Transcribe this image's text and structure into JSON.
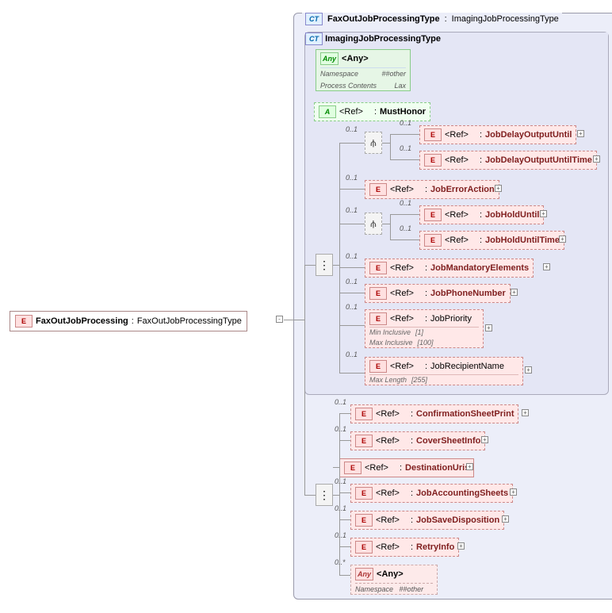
{
  "root": {
    "icon": "E",
    "name": "FaxOutJobProcessing",
    "type": "FaxOutJobProcessingType"
  },
  "ct1": {
    "icon": "CT",
    "name": "FaxOutJobProcessingType",
    "base": "ImagingJobProcessingType"
  },
  "ct2": {
    "icon": "CT",
    "name": "ImagingJobProcessingType"
  },
  "any1": {
    "icon": "Any",
    "label": "<Any>",
    "namespace_lbl": "Namespace",
    "namespace_val": "##other",
    "pc_lbl": "Process Contents",
    "pc_val": "Lax"
  },
  "attr": {
    "icon": "A",
    "label": "<Ref>",
    "name": "MustHonor"
  },
  "elems": {
    "jdou": {
      "label": "<Ref>",
      "name": "JobDelayOutputUntil"
    },
    "jdout": {
      "label": "<Ref>",
      "name": "JobDelayOutputUntilTime"
    },
    "jea": {
      "label": "<Ref>",
      "name": "JobErrorAction"
    },
    "jhu": {
      "label": "<Ref>",
      "name": "JobHoldUntil"
    },
    "jhut": {
      "label": "<Ref>",
      "name": "JobHoldUntilTime"
    },
    "jme": {
      "label": "<Ref>",
      "name": "JobMandatoryElements"
    },
    "jpn": {
      "label": "<Ref>",
      "name": "JobPhoneNumber"
    },
    "jprio": {
      "label": "<Ref>",
      "name": "JobPriority",
      "min_lbl": "Min Inclusive",
      "min_val": "[1]",
      "max_lbl": "Max Inclusive",
      "max_val": "[100]"
    },
    "jrn": {
      "label": "<Ref>",
      "name": "JobRecipientName",
      "ml_lbl": "Max Length",
      "ml_val": "[255]"
    },
    "csp": {
      "label": "<Ref>",
      "name": "ConfirmationSheetPrint"
    },
    "csi": {
      "label": "<Ref>",
      "name": "CoverSheetInfo"
    },
    "du": {
      "label": "<Ref>",
      "name": "DestinationUris"
    },
    "jas": {
      "label": "<Ref>",
      "name": "JobAccountingSheets"
    },
    "jsd": {
      "label": "<Ref>",
      "name": "JobSaveDisposition"
    },
    "ri": {
      "label": "<Ref>",
      "name": "RetryInfo"
    }
  },
  "any2": {
    "icon": "Any",
    "label": "<Any>",
    "ns_lbl": "Namespace",
    "ns_val": "##other"
  },
  "card": {
    "c01": "0..1",
    "c0s": "0..*"
  }
}
